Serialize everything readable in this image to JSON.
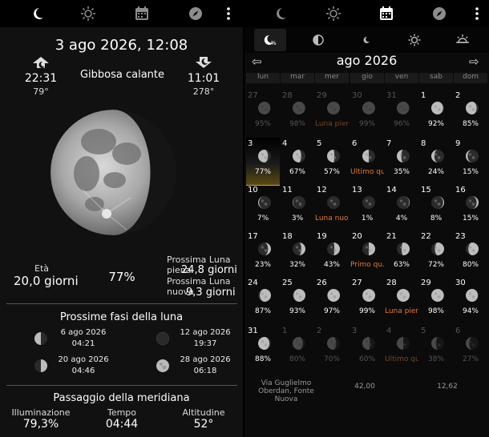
{
  "left": {
    "toolbar": {
      "icons": [
        "moon-icon",
        "sun-icon",
        "calendar-icon",
        "compass-icon",
        "more-vert-icon"
      ],
      "selected": "moon-icon"
    },
    "datetime": "3 ago 2026, 12:08",
    "moonrise": {
      "time": "22:31",
      "azimuth": "79°"
    },
    "moonset": {
      "time": "11:01",
      "azimuth": "278°"
    },
    "phase_name": "Gibbosa calante",
    "age_label": "Età",
    "age_value": "20,0 giorni",
    "illumination": "77%",
    "next_full_label": "Prossima Luna piena",
    "next_full_value": "24,8 giorni",
    "next_new_label": "Prossima Luna nuova",
    "next_new_value": "9,3 giorni",
    "next_phases_title": "Prossime fasi della luna",
    "next_phases": [
      {
        "date": "6 ago 2026",
        "time": "04:21",
        "phase": "last-quarter"
      },
      {
        "date": "12 ago 2026",
        "time": "19:37",
        "phase": "new"
      },
      {
        "date": "20 ago 2026",
        "time": "04:46",
        "phase": "first-quarter"
      },
      {
        "date": "28 ago 2026",
        "time": "06:18",
        "phase": "full"
      }
    ],
    "meridian_title": "Passaggio della meridiana",
    "meridian": {
      "illum_label": "Illuminazione",
      "illum_value": "79,3%",
      "time_label": "Tempo",
      "time_value": "04:44",
      "alt_label": "Altitudine",
      "alt_value": "52°"
    }
  },
  "right": {
    "toolbar": {
      "icons": [
        "moon-icon",
        "sun-icon",
        "calendar-icon",
        "compass-icon",
        "more-vert-icon"
      ],
      "selected": "calendar-icon"
    },
    "subtabs": [
      "moon-phase-tab",
      "moon-quarter-tab",
      "moon-crescent-tab",
      "sun-tab",
      "sunrise-tab"
    ],
    "month_title": "ago 2026",
    "prev_arrow": "⇦",
    "next_arrow": "⇨",
    "weekdays": [
      "lun",
      "mar",
      "mer",
      "gio",
      "ven",
      "sab",
      "dom"
    ],
    "weeks": [
      [
        {
          "d": "27",
          "p": "95%",
          "f": 0.95,
          "out": true
        },
        {
          "d": "28",
          "p": "98%",
          "f": 0.98,
          "out": true
        },
        {
          "d": "29",
          "p": "Luna piena",
          "f": 1,
          "out": true,
          "ev": true
        },
        {
          "d": "30",
          "p": "99%",
          "f": 0.99,
          "out": true
        },
        {
          "d": "31",
          "p": "96%",
          "f": 0.96,
          "out": true
        },
        {
          "d": "1",
          "p": "92%",
          "f": 0.92
        },
        {
          "d": "2",
          "p": "85%",
          "f": 0.85
        }
      ],
      [
        {
          "d": "3",
          "p": "77%",
          "f": 0.77,
          "today": true
        },
        {
          "d": "4",
          "p": "67%",
          "f": 0.67
        },
        {
          "d": "5",
          "p": "57%",
          "f": 0.57
        },
        {
          "d": "6",
          "p": "Ultimo qu...",
          "f": 0.5,
          "ev": true
        },
        {
          "d": "7",
          "p": "35%",
          "f": 0.35
        },
        {
          "d": "8",
          "p": "24%",
          "f": 0.24
        },
        {
          "d": "9",
          "p": "15%",
          "f": 0.15
        }
      ],
      [
        {
          "d": "10",
          "p": "7%",
          "f": 0.07
        },
        {
          "d": "11",
          "p": "3%",
          "f": 0.03
        },
        {
          "d": "12",
          "p": "Luna nuo...",
          "f": 0,
          "ev": true
        },
        {
          "d": "13",
          "p": "1%",
          "f": 0.01,
          "wax": true
        },
        {
          "d": "14",
          "p": "4%",
          "f": 0.04,
          "wax": true
        },
        {
          "d": "15",
          "p": "8%",
          "f": 0.08,
          "wax": true
        },
        {
          "d": "16",
          "p": "15%",
          "f": 0.15,
          "wax": true
        }
      ],
      [
        {
          "d": "17",
          "p": "23%",
          "f": 0.23,
          "wax": true
        },
        {
          "d": "18",
          "p": "32%",
          "f": 0.32,
          "wax": true
        },
        {
          "d": "19",
          "p": "43%",
          "f": 0.43,
          "wax": true
        },
        {
          "d": "20",
          "p": "Primo qu...",
          "f": 0.5,
          "wax": true,
          "ev": true
        },
        {
          "d": "21",
          "p": "63%",
          "f": 0.63,
          "wax": true
        },
        {
          "d": "22",
          "p": "72%",
          "f": 0.72,
          "wax": true
        },
        {
          "d": "23",
          "p": "80%",
          "f": 0.8,
          "wax": true
        }
      ],
      [
        {
          "d": "24",
          "p": "87%",
          "f": 0.87,
          "wax": true
        },
        {
          "d": "25",
          "p": "93%",
          "f": 0.93,
          "wax": true
        },
        {
          "d": "26",
          "p": "97%",
          "f": 0.97,
          "wax": true
        },
        {
          "d": "27",
          "p": "99%",
          "f": 0.99,
          "wax": true
        },
        {
          "d": "28",
          "p": "Luna piena",
          "f": 1,
          "ev": true
        },
        {
          "d": "29",
          "p": "98%",
          "f": 0.98
        },
        {
          "d": "30",
          "p": "94%",
          "f": 0.94
        }
      ],
      [
        {
          "d": "31",
          "p": "88%",
          "f": 0.88
        },
        {
          "d": "1",
          "p": "80%",
          "f": 0.8,
          "out": true
        },
        {
          "d": "2",
          "p": "70%",
          "f": 0.7,
          "out": true
        },
        {
          "d": "3",
          "p": "60%",
          "f": 0.6,
          "out": true
        },
        {
          "d": "4",
          "p": "Ultimo quarto",
          "f": 0.5,
          "out": true,
          "ev": true
        },
        {
          "d": "5",
          "p": "38%",
          "f": 0.38,
          "out": true
        },
        {
          "d": "6",
          "p": "27%",
          "f": 0.27,
          "out": true
        }
      ]
    ],
    "footer": {
      "location": "Via Guglielmo Oberdan, Fonte Nuova",
      "lat": "42,00",
      "lon": "12,62"
    },
    "colors": {
      "accent": "#e8772e",
      "today": "#c9a52a"
    }
  }
}
